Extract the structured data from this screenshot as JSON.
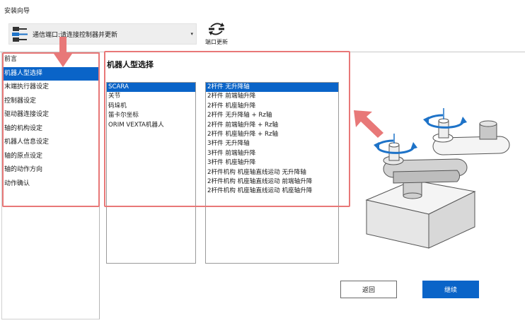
{
  "window": {
    "title": "安装向导"
  },
  "port": {
    "label": "通信端口:请连接控制器并更新",
    "dropdown_icon": "triangle-down",
    "update_label": "端口更新"
  },
  "nav": {
    "items": [
      {
        "label": "前言",
        "selected": false
      },
      {
        "label": "机器人型选择",
        "selected": true
      },
      {
        "label": "末端执行器设定",
        "selected": false
      },
      {
        "label": "控制器设定",
        "selected": false
      },
      {
        "label": "驱动器连接设定",
        "selected": false
      },
      {
        "label": "轴的机构设定",
        "selected": false
      },
      {
        "label": "机器人信息设定",
        "selected": false
      },
      {
        "label": "轴的原点设定",
        "selected": false
      },
      {
        "label": "轴的动作方向",
        "selected": false
      },
      {
        "label": "动作确认",
        "selected": false
      }
    ]
  },
  "main": {
    "title": "机器人型选择",
    "robot_types": [
      {
        "label": "SCARA",
        "selected": true
      },
      {
        "label": "关节",
        "selected": false
      },
      {
        "label": "码垛机",
        "selected": false
      },
      {
        "label": "笛卡尔坐标",
        "selected": false
      },
      {
        "label": "ORIM VEXTA机器人",
        "selected": false
      }
    ],
    "models": [
      {
        "label": "2杆件 无升降轴",
        "selected": true
      },
      {
        "label": "2杆件 前端轴升降",
        "selected": false
      },
      {
        "label": "2杆件 机座轴升降",
        "selected": false
      },
      {
        "label": "2杆件 无升降轴 + Rz轴",
        "selected": false
      },
      {
        "label": "2杆件 前端轴升降 + Rz轴",
        "selected": false
      },
      {
        "label": "2杆件 机座轴升降 + Rz轴",
        "selected": false
      },
      {
        "label": "3杆件 无升降轴",
        "selected": false
      },
      {
        "label": "3杆件 前端轴升降",
        "selected": false
      },
      {
        "label": "3杆件 机座轴升降",
        "selected": false
      },
      {
        "label": "2杆件机构 机座轴直线运动 无升降轴",
        "selected": false
      },
      {
        "label": "2杆件机构 机座轴直线运动 前端轴升降",
        "selected": false
      },
      {
        "label": "2杆件机构 机座轴直线运动 机座轴升降",
        "selected": false
      }
    ]
  },
  "buttons": {
    "back": "返回",
    "next": "继续"
  },
  "colors": {
    "accent": "#0a64c8",
    "annotation": "#e87878"
  },
  "icons": {
    "port": "usb-plug-icon",
    "update": "refresh-cable-icon"
  }
}
